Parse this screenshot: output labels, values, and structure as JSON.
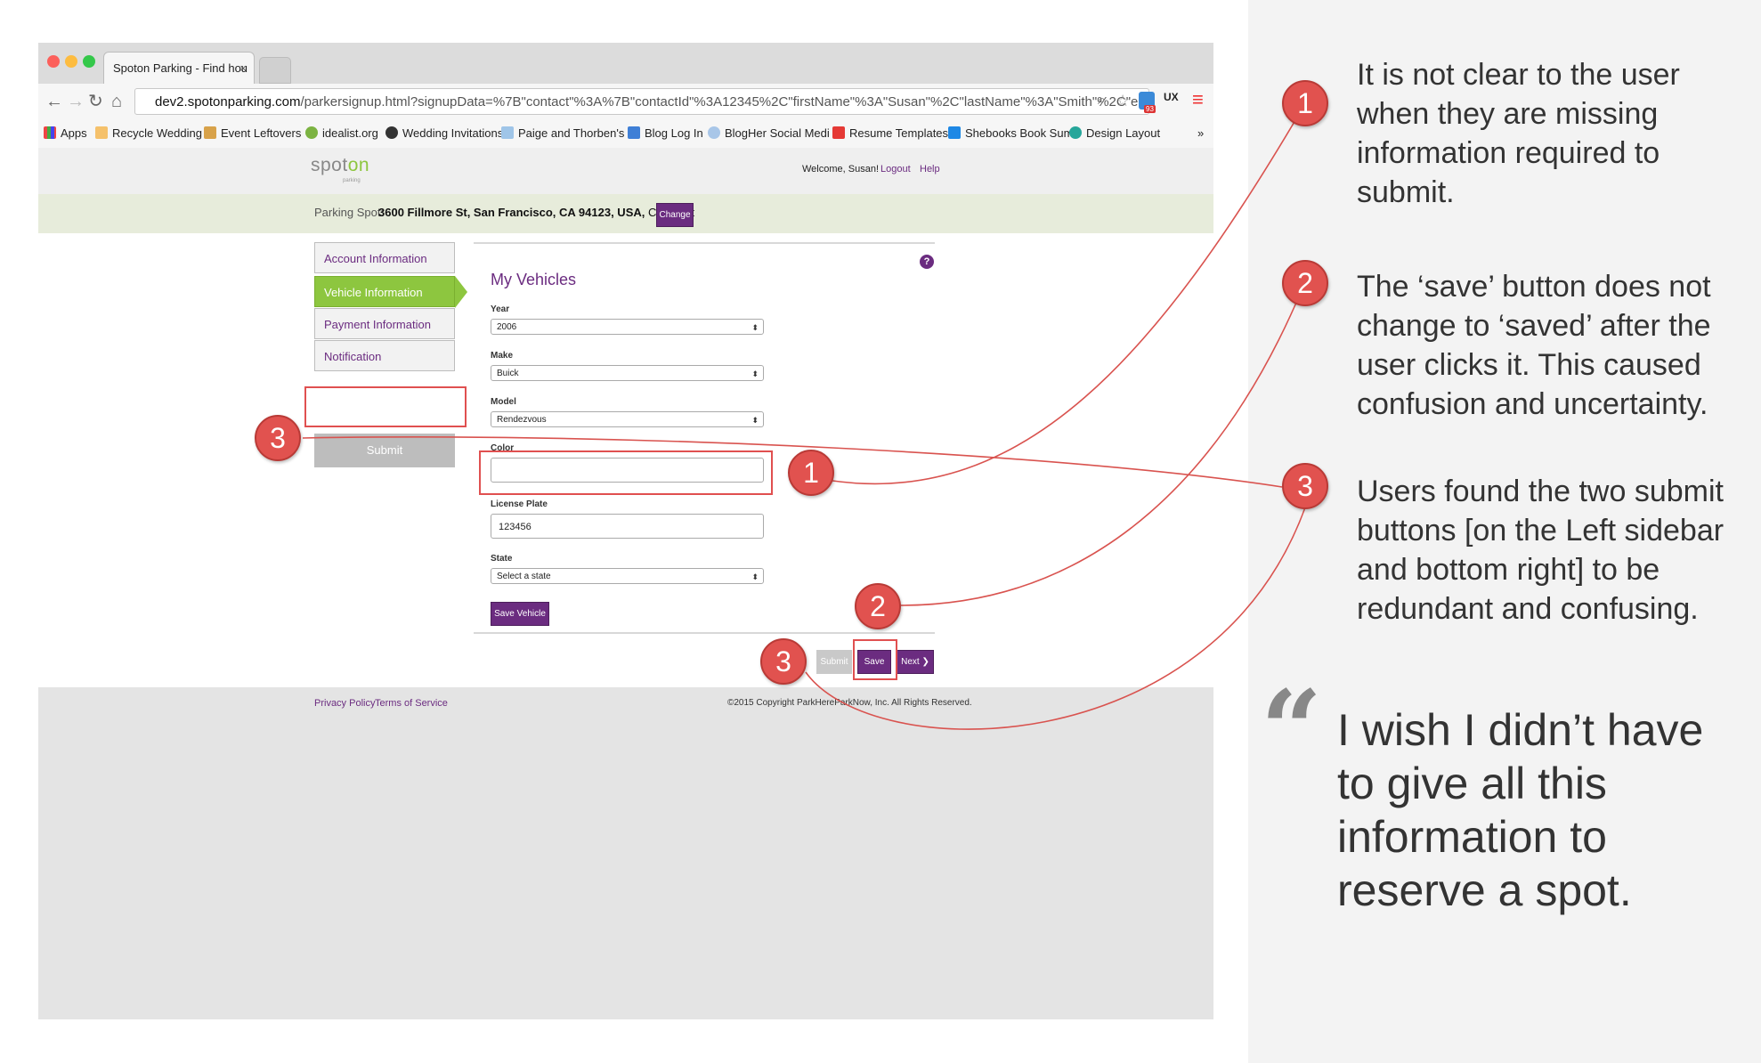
{
  "browser": {
    "tab_title": "Spoton Parking - Find hou",
    "tab_close": "×",
    "url_host": "dev2.spotonparking.com",
    "url_rest": "/parkersignup.html?signupData=%7B\"contact\"%3A%7B\"contactId\"%3A12345%2C\"firstName\"%3A\"Susan\"%2C\"lastName\"%3A\"Smith\"%2C\"email\"%...",
    "bookmarks": [
      "Apps",
      "Recycle Wedding",
      "Event Leftovers",
      "idealist.org",
      "Wedding Invitations",
      "Paige and Thorben's",
      "Blog Log In",
      "BlogHer Social Medi",
      "Resume Templates",
      "Shebooks Book Sum",
      "Design Layout"
    ],
    "more": "»",
    "ext_badge": "93",
    "ext_label": "UX"
  },
  "site": {
    "logo_a": "spot",
    "logo_b": "on",
    "logo_sub": "parking",
    "welcome": "Welcome, Susan!",
    "logout": "Logout",
    "help": "Help",
    "spot_label": "Parking Spot:",
    "spot_address": "3600 Fillmore St, San Francisco, CA 94123, USA,",
    "spot_type": " Curb Cut",
    "change_button": "Change",
    "menu": [
      "Account Information",
      "Vehicle Information",
      "Payment Information",
      "Notification"
    ],
    "side_submit": "Submit",
    "help_icon": "?",
    "form_title": "My Vehicles",
    "year_label": "Year",
    "year_value": "2006",
    "make_label": "Make",
    "make_value": "Buick",
    "model_label": "Model",
    "model_value": "Rendezvous",
    "color_label": "Color",
    "color_value": "",
    "plate_label": "License Plate",
    "plate_value": "123456",
    "state_label": "State",
    "state_value": "Select a state",
    "save_vehicle": "Save Vehicle",
    "bottom_submit": "Submit",
    "bottom_save": "Save",
    "bottom_next": "Next ❯",
    "privacy": "Privacy Policy",
    "terms": "Terms of Service",
    "copyright": "©2015 Copyright ParkHereParkNow, Inc. All Rights Reserved."
  },
  "annotations": {
    "badges": [
      "1",
      "2",
      "3"
    ],
    "notes": [
      {
        "num": "1",
        "text": "It is not clear to the user when they are missing information required to submit."
      },
      {
        "num": "2",
        "text": "The ‘save’ button does not change to ‘saved’ after the user clicks it. This caused confusion and uncertainty."
      },
      {
        "num": "3",
        "text": "Users found the two submit buttons [on the Left sidebar and bottom right] to be redundant and confusing."
      }
    ],
    "quote_mark": "“",
    "quote": "I wish I didn’t have to give all this information to reserve a spot."
  },
  "colors": {
    "accent": "#6b2c80",
    "green": "#8dc63f",
    "annotation_red": "#e1524f"
  }
}
